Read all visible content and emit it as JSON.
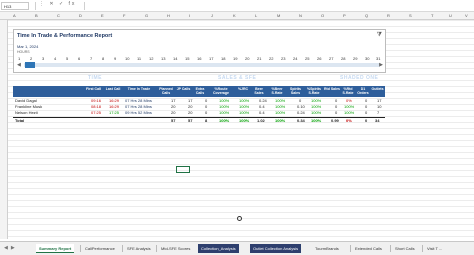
{
  "formula_bar": {
    "name_box": "H13",
    "fx_icons": "⋮ ✕ ✓ fx"
  },
  "columns": [
    "A",
    "B",
    "C",
    "D",
    "E",
    "F",
    "G",
    "H",
    "I",
    "J",
    "K",
    "L",
    "M",
    "N",
    "O",
    "P",
    "Q",
    "R",
    "S",
    "T",
    "U",
    "V"
  ],
  "card": {
    "title": "Time In Trade & Performance Report",
    "filter_icon": "filter-icon",
    "date": "Mar 1, 2024",
    "hours_label": "HOURS",
    "scale": [
      "1",
      "2",
      "3",
      "4",
      "5",
      "6",
      "7",
      "8",
      "9",
      "10",
      "11",
      "12",
      "13",
      "14",
      "15",
      "16",
      "17",
      "18",
      "19",
      "20",
      "21",
      "22",
      "23",
      "24",
      "25",
      "26",
      "27",
      "28",
      "29",
      "30",
      "31"
    ]
  },
  "sections": {
    "time": "TIME",
    "sales": "SALES & SFE",
    "shaded": "SHADED ONE"
  },
  "table": {
    "headers": [
      "",
      "First Call",
      "Last Call",
      "Time In Trade",
      "Planned Calls",
      "JP Calls",
      "Extra Calls",
      "%Route Coverage",
      "%JRC",
      "Beer Sales",
      "%Beer S.Rate",
      "Spirits Sales",
      "%Spirits S.Rate",
      "Rtd Sales",
      "%Rtd S.Rate",
      "D1 Orders",
      "Outlets"
    ],
    "rows": [
      {
        "name": "David Dagal",
        "first": "09:16",
        "last": "16:29",
        "tit": "07 Hrs 28 Mins",
        "planned": "17",
        "jp": "17",
        "extra": "0",
        "cov": "100%",
        "jrc": "100%",
        "beer": "0.24",
        "beer_r": "100%",
        "spirits": "0",
        "spirits_r": "100%",
        "rtd": "0",
        "rtd_r": "0%",
        "orders": "0",
        "outlets": "17"
      },
      {
        "name": "Frankline Musk",
        "first": "08:18",
        "last": "16:29",
        "tit": "07 Hrs 28 Mins",
        "planned": "20",
        "jp": "20",
        "extra": "0",
        "cov": "100%",
        "jrc": "100%",
        "beer": "0.4",
        "beer_r": "100%",
        "spirits": "0.10",
        "spirits_r": "100%",
        "rtd": "0",
        "rtd_r": "100%",
        "orders": "0",
        "outlets": "10"
      },
      {
        "name": "Nelson Hezti",
        "first": "07:25",
        "last": "17:25",
        "tit": "09 Hrs 52 Mins",
        "planned": "20",
        "jp": "20",
        "extra": "0",
        "cov": "100%",
        "jrc": "100%",
        "beer": "0.4",
        "beer_r": "100%",
        "spirits": "0.24",
        "spirits_r": "100%",
        "rtd": "0",
        "rtd_r": "100%",
        "orders": "0",
        "outlets": "7"
      }
    ],
    "total": {
      "name": "Total",
      "planned": "57",
      "jp": "57",
      "extra": "8",
      "cov": "100%",
      "jrc": "100%",
      "beer": "1.02",
      "beer_r": "100%",
      "spirits": "0.34",
      "spirits_r": "100%",
      "rtd": "0.99",
      "rtd_r": "0%",
      "orders": "0",
      "outlets": "34"
    }
  },
  "sheet_tabs": [
    "Summary Report",
    "CallPerformance",
    "SFE Analysis",
    "Mtd-SFE Scores",
    "Collection_Analysis",
    "Outlet Collection Analysis",
    "TourmBrands",
    "Extended Calls",
    "Short Calls",
    "Visit T ..."
  ]
}
